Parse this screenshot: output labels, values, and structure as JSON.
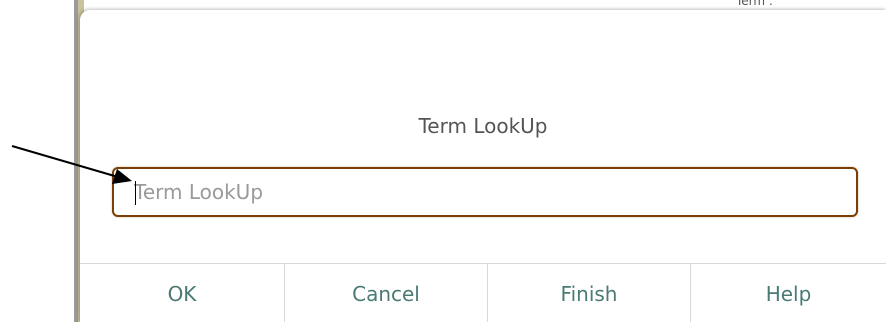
{
  "background": {
    "top_text": "Term :"
  },
  "dialog": {
    "title": "Term LookUp",
    "input": {
      "value": "",
      "placeholder": "Term LookUp"
    },
    "buttons": {
      "ok": "OK",
      "cancel": "Cancel",
      "finish": "Finish",
      "help": "Help"
    }
  },
  "colors": {
    "input_border": "#7a3f06",
    "button_text": "#4a7a74",
    "title_text": "#555555"
  },
  "annotation": {
    "icon": "arrow-pointer-icon"
  }
}
